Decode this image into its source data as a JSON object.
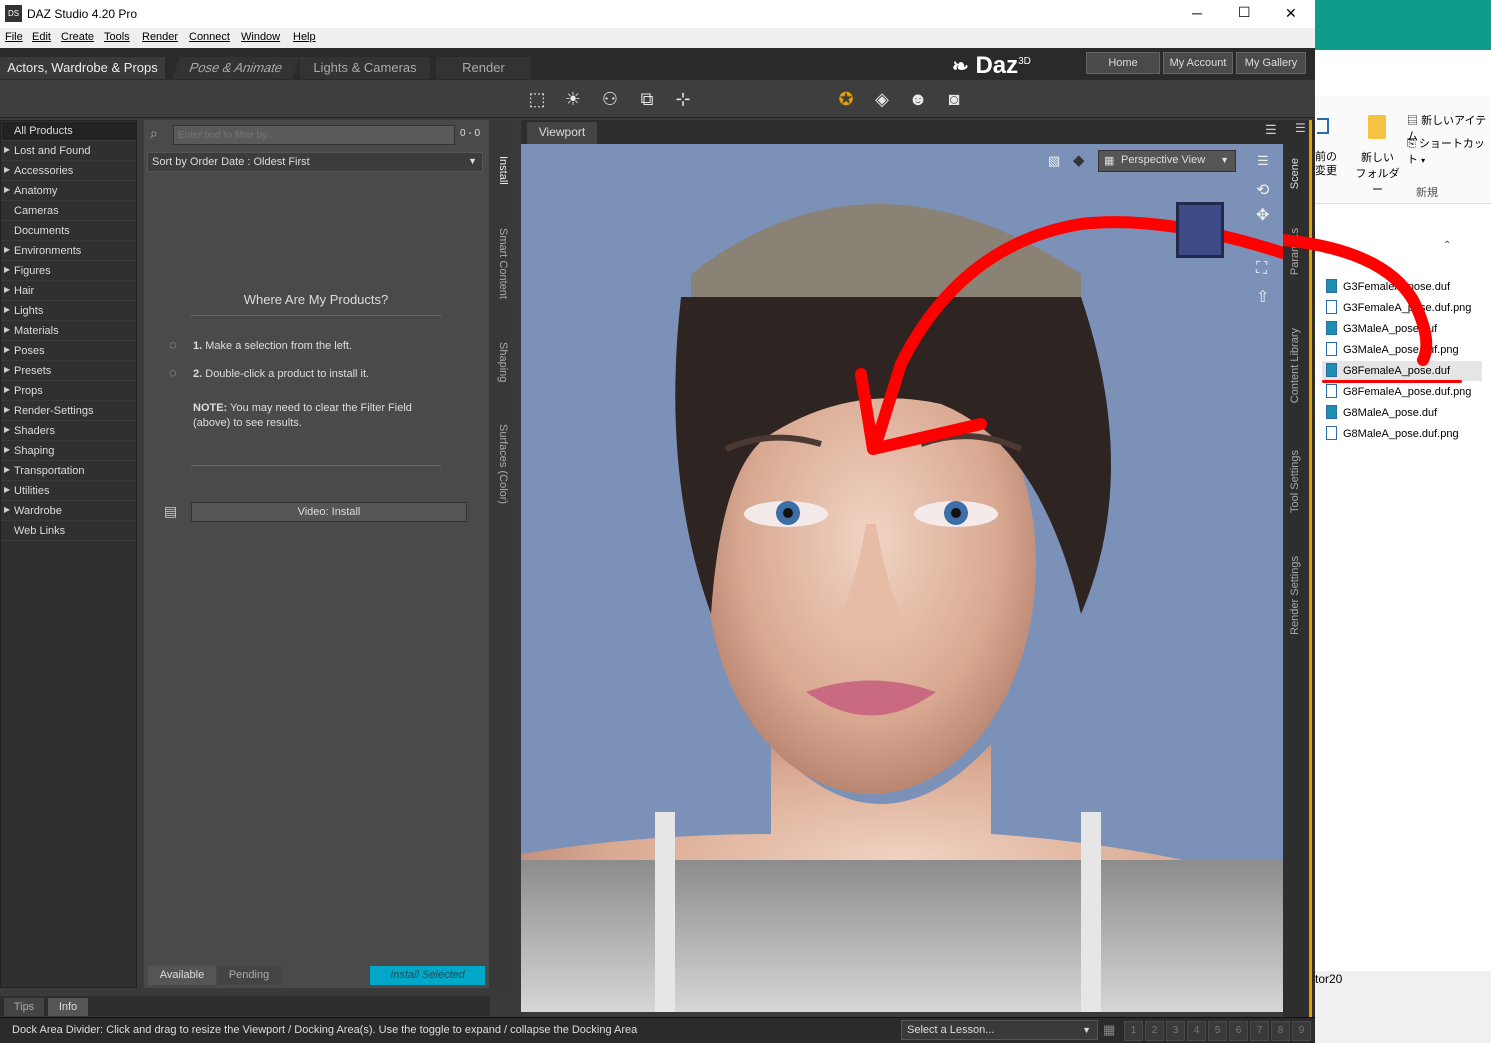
{
  "window": {
    "title": "DAZ Studio 4.20 Pro",
    "min": "─",
    "max": "☐",
    "close": "✕"
  },
  "menu": [
    "File",
    "Edit",
    "Create",
    "Tools",
    "Render",
    "Connect",
    "Window",
    "Help"
  ],
  "tabs": [
    "Actors, Wardrobe & Props",
    "Pose & Animate",
    "Lights & Cameras",
    "Render"
  ],
  "brand": "Daz",
  "brand_sup": "3D",
  "header_buttons": [
    "Home",
    "My Account",
    "My Gallery"
  ],
  "categories": [
    {
      "label": "All Products",
      "arrow": false,
      "selected": true
    },
    {
      "label": "Lost and Found",
      "arrow": true
    },
    {
      "label": "Accessories",
      "arrow": true
    },
    {
      "label": "Anatomy",
      "arrow": true
    },
    {
      "label": "Cameras",
      "arrow": false
    },
    {
      "label": "Documents",
      "arrow": false
    },
    {
      "label": "Environments",
      "arrow": true
    },
    {
      "label": "Figures",
      "arrow": true
    },
    {
      "label": "Hair",
      "arrow": true
    },
    {
      "label": "Lights",
      "arrow": true
    },
    {
      "label": "Materials",
      "arrow": true
    },
    {
      "label": "Poses",
      "arrow": true
    },
    {
      "label": "Presets",
      "arrow": true
    },
    {
      "label": "Props",
      "arrow": true
    },
    {
      "label": "Render-Settings",
      "arrow": true
    },
    {
      "label": "Shaders",
      "arrow": true
    },
    {
      "label": "Shaping",
      "arrow": true
    },
    {
      "label": "Transportation",
      "arrow": true
    },
    {
      "label": "Utilities",
      "arrow": true
    },
    {
      "label": "Wardrobe",
      "arrow": true
    },
    {
      "label": "Web Links",
      "arrow": false
    }
  ],
  "filter": {
    "placeholder": "Enter text to filter by...",
    "count": "0 - 0"
  },
  "sort": "Sort by Order Date : Oldest First",
  "install_help": {
    "title": "Where Are My Products?",
    "step1_num": "1.",
    "step1": "Make a selection from the left.",
    "step2_num": "2.",
    "step2": "Double-click a product to install it.",
    "note_label": "NOTE:",
    "note": "You may need to clear the Filter Field (above) to see results.",
    "video": "Video: Install"
  },
  "install_tabs": [
    "Available",
    "Pending",
    "Install Selected"
  ],
  "bottom_tabs": [
    "Tips",
    "Info"
  ],
  "side_tabs": [
    "Install",
    "Smart Content",
    "Shaping",
    "Surfaces (Color)"
  ],
  "right_tabs": [
    "Scene",
    "Param...s",
    "Content Library",
    "Tool Settings",
    "Render Settings"
  ],
  "viewport": {
    "tab": "Viewport",
    "view": "Perspective View"
  },
  "status": {
    "text": "Dock Area Divider: Click and drag to resize the Viewport / Docking Area(s). Use the toggle to expand / collapse the Docking Area",
    "lesson": "Select a Lesson...",
    "pages": [
      "1",
      "2",
      "3",
      "4",
      "5",
      "6",
      "7",
      "8",
      "9"
    ]
  },
  "explorer": {
    "ribbon": {
      "back": "前の",
      "back2": "変更",
      "newfolder": "新しい",
      "newfolder2": "フォルダー",
      "new_item": "新しいアイテム",
      "shortcut": "ショートカット",
      "group": "新規"
    },
    "files": [
      "G3FemaleA_pose.duf",
      "G3FemaleA_pose.duf.png",
      "G3MaleA_pose.duf",
      "G3MaleA_pose.duf.png",
      "G8FemaleA_pose.duf",
      "G8FemaleA_pose.duf.png",
      "G8MaleA_pose.duf",
      "G8MaleA_pose.duf.png"
    ],
    "selected": "G8FemaleA_pose.duf",
    "footer": "tor20"
  },
  "colors": {
    "accent": "#00a8c8",
    "annotation": "#ff0000",
    "viewport_bg": "#7b91b7",
    "orange": "#e0a000"
  }
}
